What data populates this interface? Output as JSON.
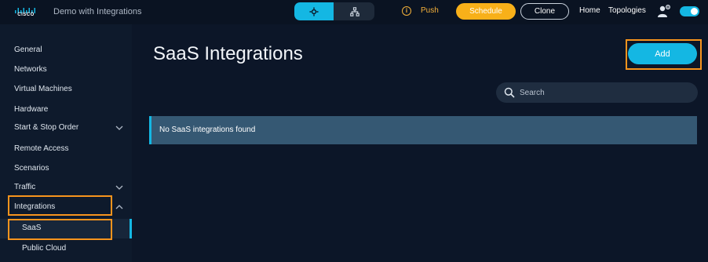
{
  "header": {
    "logo_text": "CISCO",
    "app_title": "Demo with Integrations",
    "push_label": "Push",
    "schedule_label": "Schedule",
    "clone_label": "Clone",
    "home_label": "Home",
    "topologies_label": "Topologies",
    "icons": [
      "design-view-icon",
      "topology-view-icon",
      "info-icon",
      "user-settings-icon",
      "toggle-switch"
    ]
  },
  "sidebar": {
    "items": [
      {
        "label": "General"
      },
      {
        "label": "Networks"
      },
      {
        "label": "Virtual Machines"
      },
      {
        "label": "Hardware"
      },
      {
        "label": "Start & Stop Order"
      },
      {
        "label": "Remote Access"
      },
      {
        "label": "Scenarios"
      },
      {
        "label": "Traffic"
      },
      {
        "label": "Integrations"
      },
      {
        "label": "SaaS"
      },
      {
        "label": "Public Cloud"
      }
    ]
  },
  "main": {
    "title": "SaaS Integrations",
    "add_label": "Add",
    "search_placeholder": "Search",
    "empty_message": "No SaaS integrations found"
  },
  "colors": {
    "accent": "#14b7e3",
    "schedule": "#f8b019",
    "highlight": "#f7941d",
    "background": "#0c1628"
  }
}
